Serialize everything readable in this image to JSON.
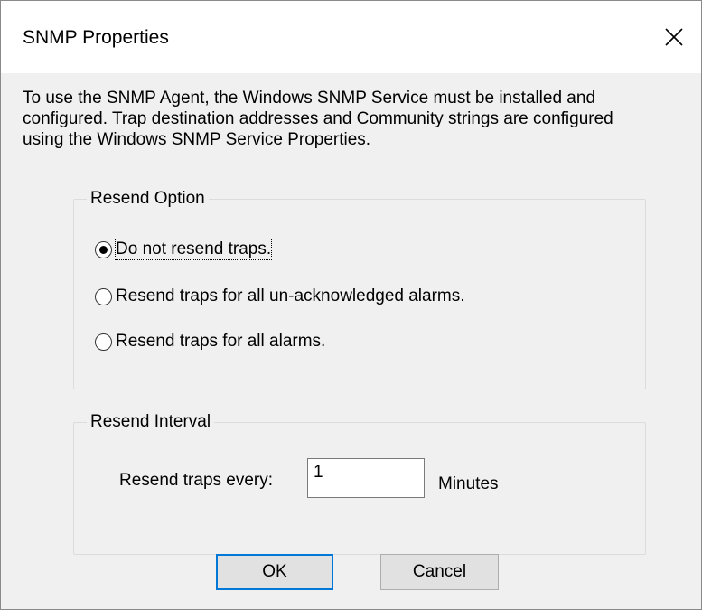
{
  "window": {
    "title": "SNMP Properties",
    "close_icon": "close-icon"
  },
  "description": {
    "lines": [
      "To use the SNMP Agent, the Windows SNMP Service must be installed and",
      "configured. Trap destination addresses and Community strings are configured",
      "using the Windows SNMP Service Properties."
    ]
  },
  "resend_option": {
    "legend": "Resend Option",
    "options": [
      {
        "label": "Do not resend traps.",
        "selected": true
      },
      {
        "label": "Resend traps for all un-acknowledged alarms.",
        "selected": false
      },
      {
        "label": "Resend traps for all alarms.",
        "selected": false
      }
    ]
  },
  "resend_interval": {
    "legend": "Resend Interval",
    "label": "Resend traps every:",
    "value": "1",
    "units": "Minutes"
  },
  "buttons": {
    "ok": "OK",
    "cancel": "Cancel"
  },
  "colors": {
    "dialog_bg": "#f0f0f0",
    "titlebar_bg": "#ffffff",
    "default_button_border": "#0078d7",
    "button_bg": "#e1e1e1"
  }
}
